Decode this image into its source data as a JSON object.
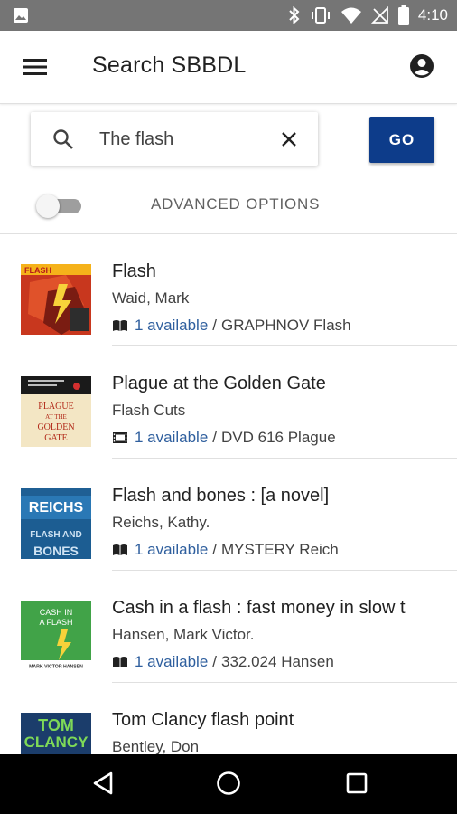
{
  "status_bar": {
    "time": "4:10",
    "icons": [
      "image-icon",
      "bluetooth-icon",
      "vibrate-icon",
      "wifi-icon",
      "no-signal-icon",
      "battery-icon"
    ]
  },
  "app_bar": {
    "title": "Search SBBDL",
    "menu_icon": "hamburger-menu-icon",
    "account_icon": "account-circle-icon"
  },
  "search": {
    "value": "The flash",
    "search_icon": "search-icon",
    "clear_icon": "close-icon",
    "go_label": "GO"
  },
  "advanced": {
    "label": "ADVANCED OPTIONS",
    "enabled": false
  },
  "results": [
    {
      "title": "Flash",
      "author": "Waid, Mark",
      "format_icon": "book-icon",
      "availability": "1 available",
      "separator": "/",
      "call_number": "GRAPHNOV Flash"
    },
    {
      "title": "Plague at the Golden Gate",
      "author": "Flash Cuts",
      "format_icon": "film-icon",
      "availability": "1 available",
      "separator": "/",
      "call_number": "DVD 616 Plague"
    },
    {
      "title": "Flash and bones : [a novel]",
      "author": "Reichs, Kathy.",
      "format_icon": "book-icon",
      "availability": "1 available",
      "separator": "/",
      "call_number": "MYSTERY Reich"
    },
    {
      "title": "Cash in a flash : fast money in slow t",
      "author": "Hansen, Mark Victor.",
      "format_icon": "book-icon",
      "availability": "1 available",
      "separator": "/",
      "call_number": "332.024 Hansen"
    },
    {
      "title": "Tom Clancy flash point",
      "author": "Bentley, Don",
      "format_icon": "book-icon",
      "availability": "",
      "separator": "",
      "call_number": ""
    }
  ],
  "covers": [
    {
      "texts": [
        "FLASH"
      ],
      "bg": "#c8371e"
    },
    {
      "texts": [
        "PLAGUE",
        "AT THE",
        "GOLDEN",
        "GATE"
      ],
      "bg": "#f3e6c4"
    },
    {
      "texts": [
        "REICHS",
        "FLASH AND",
        "BONES"
      ],
      "bg": "#2a78b5"
    },
    {
      "texts": [
        "CASH IN",
        "A FLASH",
        "MARK VICTOR HANSEN"
      ],
      "bg": "#4caf50"
    },
    {
      "texts": [
        "TOM",
        "CLANCY"
      ],
      "bg": "#1b3d6b"
    }
  ],
  "nav_bar": {
    "back_icon": "back-triangle-icon",
    "home_icon": "home-circle-icon",
    "recents_icon": "recents-square-icon"
  }
}
